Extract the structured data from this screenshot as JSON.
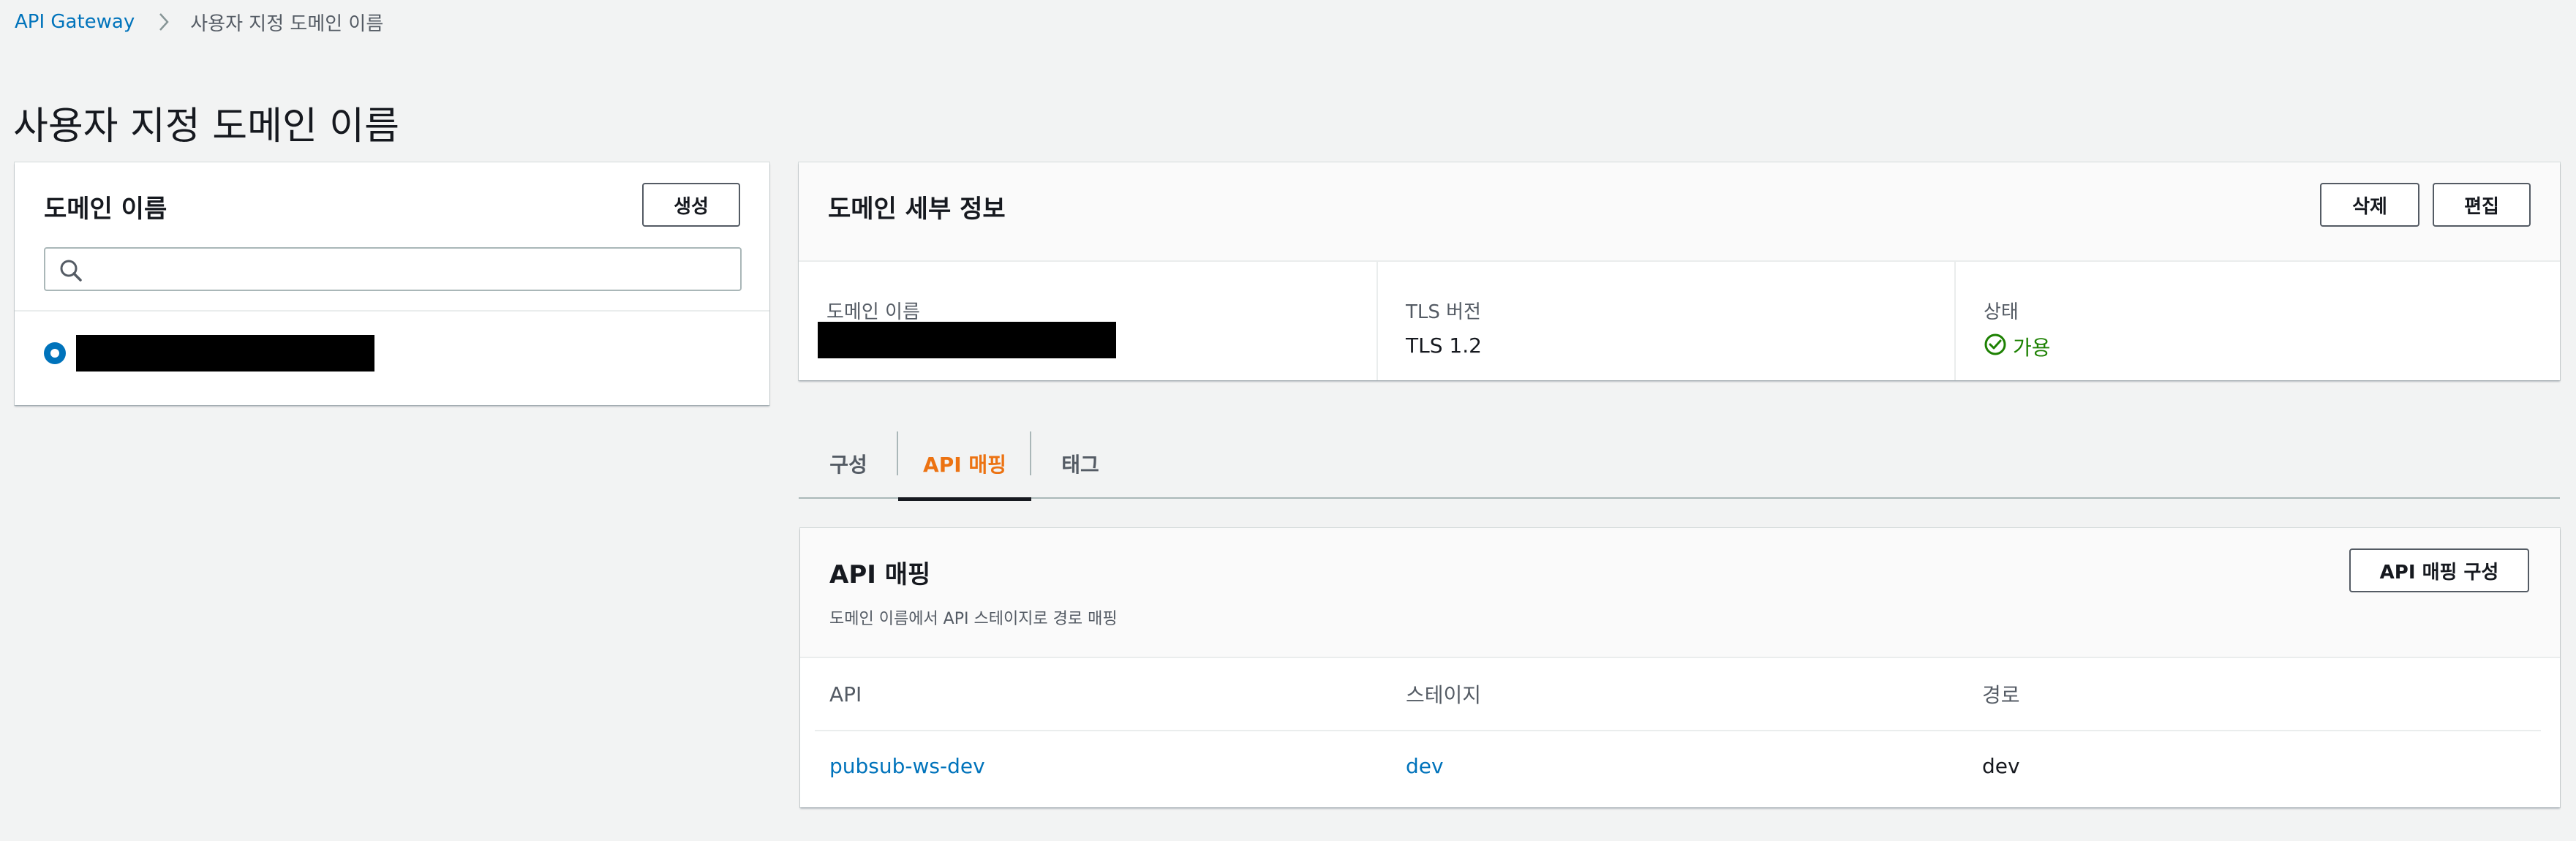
{
  "breadcrumb": {
    "root": "API Gateway",
    "current": "사용자 지정 도메인 이름"
  },
  "page": {
    "title": "사용자 지정 도메인 이름"
  },
  "domain_list": {
    "title": "도메인 이름",
    "create_button": "생성",
    "search_placeholder": ""
  },
  "domain_details": {
    "title": "도메인 세부 정보",
    "delete_button": "삭제",
    "edit_button": "편집",
    "domain_name_label": "도메인 이름",
    "tls_label": "TLS 버전",
    "tls_value": "TLS 1.2",
    "status_label": "상태",
    "status_value": "가용"
  },
  "tabs": [
    {
      "label": "구성",
      "active": false
    },
    {
      "label": "API 매핑",
      "active": true
    },
    {
      "label": "태그",
      "active": false
    }
  ],
  "api_mapping": {
    "title": "API 매핑",
    "description": "도메인 이름에서 API 스테이지로 경로 매핑",
    "configure_button": "API 매핑 구성",
    "columns": [
      "API",
      "스테이지",
      "경로"
    ],
    "rows": [
      {
        "api": "pubsub-ws-dev",
        "stage": "dev",
        "path": "dev"
      }
    ]
  },
  "colors": {
    "link": "#0073bb",
    "active_tab": "#ec7211",
    "success": "#1d8102",
    "background": "#f2f3f3"
  },
  "icons": [
    "chevron-right-icon",
    "search-icon",
    "check-circle-icon"
  ]
}
